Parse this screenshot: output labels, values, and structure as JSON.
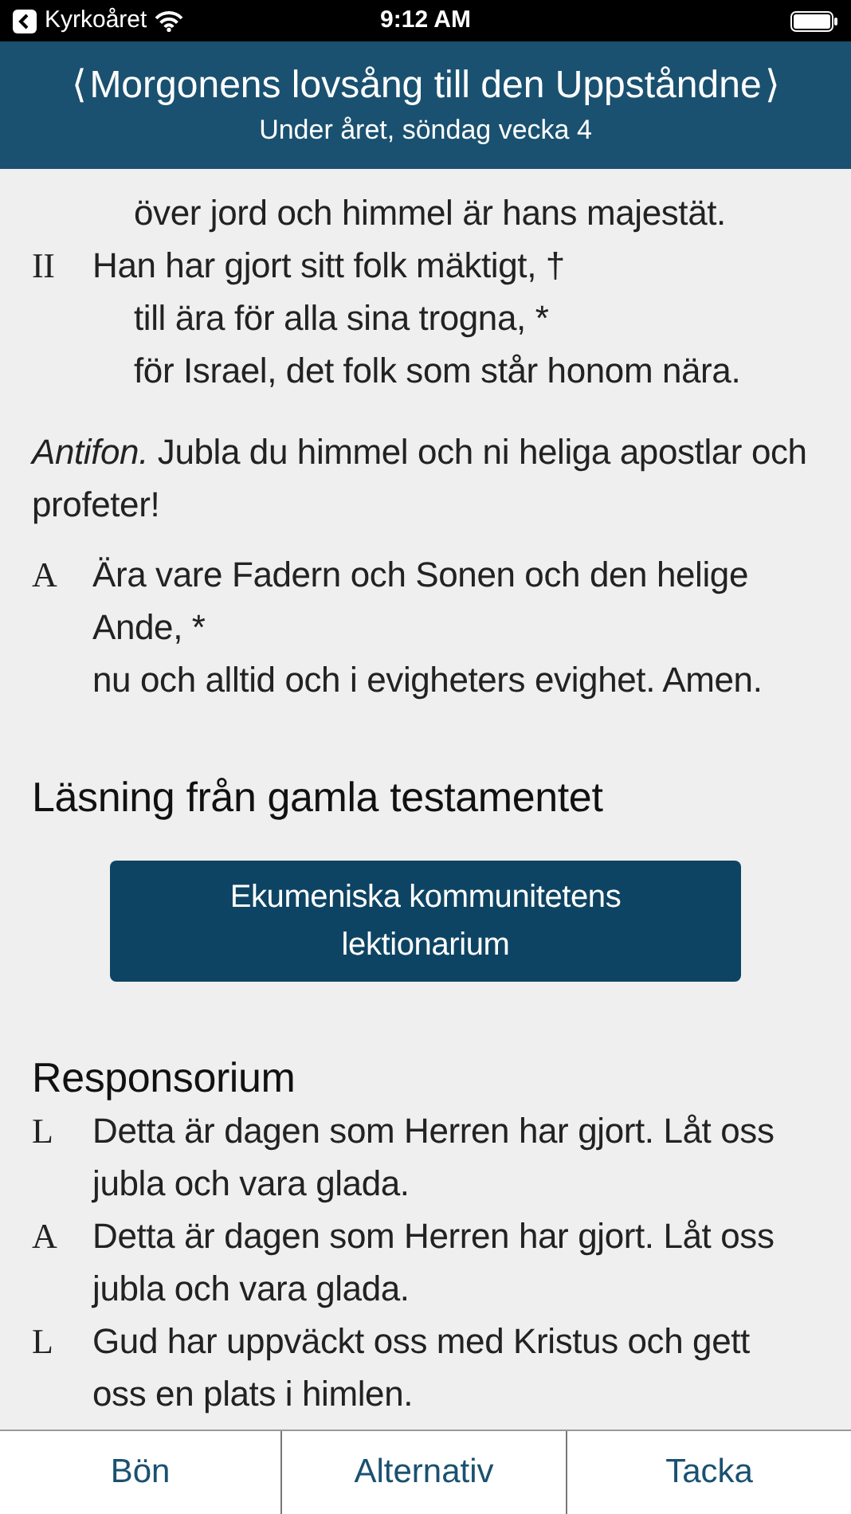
{
  "status_bar": {
    "back_label": "Kyrkoåret",
    "time": "9:12 AM"
  },
  "header": {
    "prev": "⟨",
    "title": "Morgonens lovsång till den Uppståndne",
    "next": "⟩",
    "subtitle": "Under året, söndag vecka 4"
  },
  "verses": [
    {
      "lines": [
        {
          "text": "över jord och himmel är hans majestät.",
          "kind": "continuation"
        }
      ]
    },
    {
      "marker": "II",
      "lines": [
        {
          "text": "Han har gjort sitt folk mäktigt, †",
          "kind": "first"
        },
        {
          "text": "till ära för alla sina trogna, *",
          "kind": "continuation"
        },
        {
          "text": "för Israel, det folk som står honom nära.",
          "kind": "continuation"
        }
      ]
    }
  ],
  "antiphon": "*Antifon.* Jubla du himmel och ni heliga apostlar och profeter!",
  "doxology": {
    "marker": "A",
    "lines": [
      "Ära vare Fadern och Sonen och den helige Ande, *",
      "nu och alltid och i evigheters evighet. Amen."
    ]
  },
  "reading_heading": "Läsning från gamla testamentet",
  "reading_button": "Ekumeniska kommunitetens lektionarium",
  "responsorium_heading": "Responsorium",
  "responsorium": [
    {
      "marker": "L",
      "text": "Detta är dagen som Herren har gjort. Låt oss jubla och vara glada."
    },
    {
      "marker": "A",
      "text": "Detta är dagen som Herren har gjort. Låt oss jubla och vara glada."
    },
    {
      "marker": "L",
      "text": "Gud har uppväckt oss med Kristus och gett oss en plats i himlen."
    }
  ],
  "tabs": [
    {
      "label": "Bön"
    },
    {
      "label": "Alternativ"
    },
    {
      "label": "Tacka"
    }
  ]
}
